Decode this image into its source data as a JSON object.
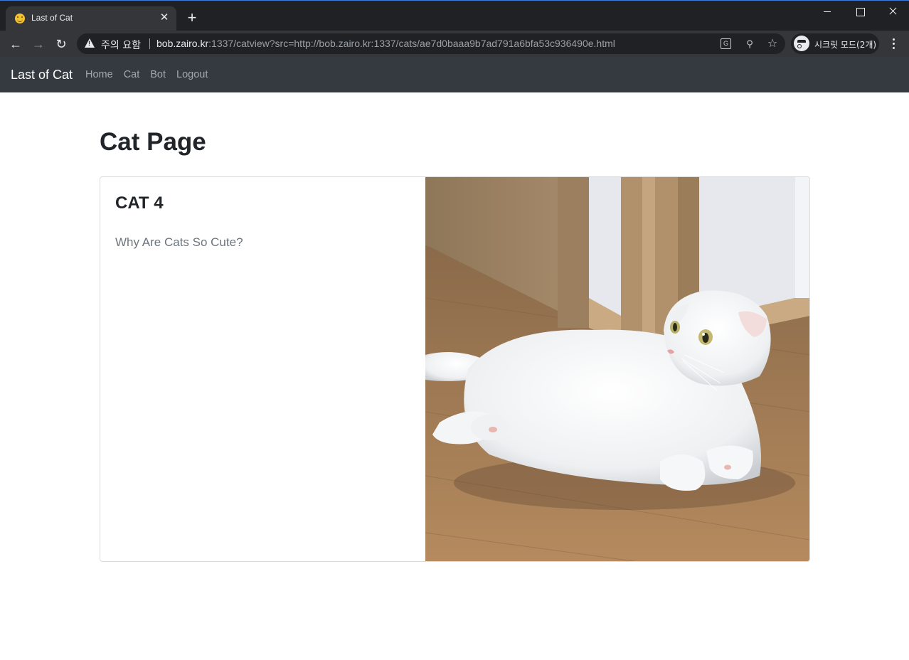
{
  "browser": {
    "tab_title": "Last of Cat",
    "tab_close": "✕",
    "new_tab": "+",
    "security_warning": "주의 요함",
    "url_host": "bob.zairo.kr",
    "url_rest": ":1337/catview?src=http://bob.zairo.kr:1337/cats/ae7d0baaa9b7ad791a6bfa53c936490e.html",
    "profile_label": "시크릿 모드(2개)",
    "icons": {
      "back": "←",
      "forward": "→",
      "reload": "↻",
      "zoom": "⚲",
      "star": "☆",
      "translate": "G"
    }
  },
  "navbar": {
    "brand": "Last of Cat",
    "links": [
      "Home",
      "Cat",
      "Bot",
      "Logout"
    ]
  },
  "main": {
    "page_title": "Cat Page",
    "card": {
      "title": "CAT 4",
      "text": "Why Are Cats So Cute?",
      "image_subject": "white scottish fold cat lying on wooden floor"
    }
  }
}
